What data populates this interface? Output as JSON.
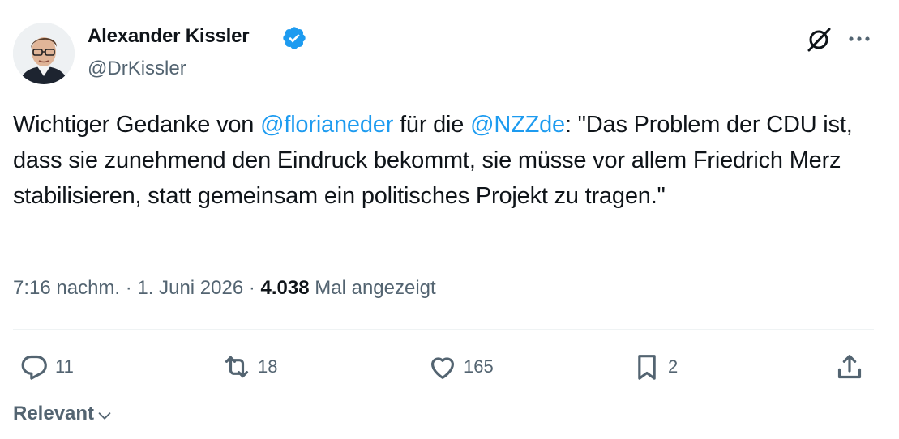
{
  "author": {
    "display_name": "Alexander Kissler",
    "handle": "@DrKissler",
    "verified": true
  },
  "tweet": {
    "text_part1": "Wichtiger Gedanke von ",
    "mention1": "@florianeder",
    "text_part2": " für die ",
    "mention2": "@NZZde",
    "text_part3": ": \"Das Problem der CDU ist, dass sie zunehmend den Eindruck bekommt, sie müsse vor allem Friedrich Merz stabilisieren, statt gemeinsam ein politisches Projekt zu tragen.\""
  },
  "meta": {
    "time": "7:16 nachm.",
    "sep1": " · ",
    "date": "1. Juni 2026",
    "sep2": " · ",
    "views_count": "4.038",
    "views_label": " Mal angezeigt"
  },
  "actions": {
    "replies": "11",
    "reposts": "18",
    "likes": "165",
    "bookmarks": "2"
  },
  "sort": {
    "label": "Relevant"
  },
  "colors": {
    "accent": "#1d9bf0",
    "secondary_text": "#536471",
    "primary_text": "#0f1419"
  },
  "icons": [
    "verified-badge-icon",
    "grok-icon",
    "more-icon",
    "reply-icon",
    "repost-icon",
    "like-icon",
    "bookmark-icon",
    "share-icon",
    "chevron-down-icon"
  ]
}
